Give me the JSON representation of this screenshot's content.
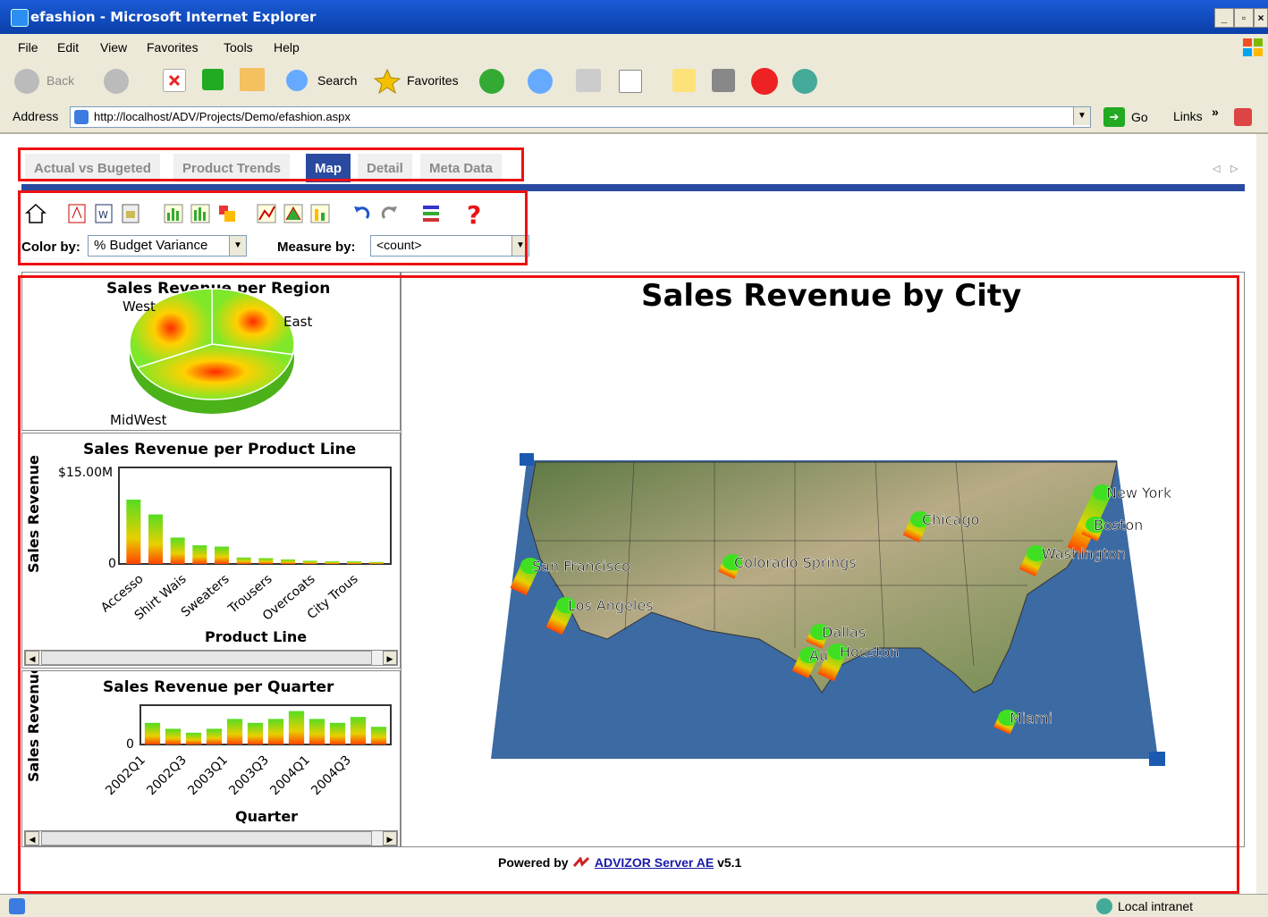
{
  "window": {
    "title": "efashion - Microsoft Internet Explorer"
  },
  "menu": [
    "File",
    "Edit",
    "View",
    "Favorites",
    "Tools",
    "Help"
  ],
  "toolbar": {
    "back": "Back",
    "search": "Search",
    "favorites": "Favorites",
    "go": "Go",
    "links": "Links"
  },
  "address": {
    "label": "Address",
    "url": "http://localhost/ADV/Projects/Demo/efashion.aspx"
  },
  "tabs": [
    "Actual vs Bugeted",
    "Product Trends",
    "Map",
    "Detail",
    "Meta Data"
  ],
  "active_tab": "Map",
  "controls": {
    "color_by_label": "Color by:",
    "color_by_value": "% Budget Variance",
    "measure_by_label": "Measure by:",
    "measure_by_value": "<count>"
  },
  "footer": {
    "powered_by": "Powered by",
    "link": "ADVIZOR Server AE",
    "version": "v5.1"
  },
  "status": {
    "zone": "Local intranet"
  },
  "colors": {
    "accent": "#2a4aa0",
    "highlight": "#ee1111",
    "bar_top": "#55dd22",
    "bar_bottom": "#ff4400"
  },
  "chart_data": [
    {
      "type": "pie",
      "title": "Sales Revenue per Region",
      "labels": [
        "West",
        "East",
        "MidWest"
      ],
      "values": [
        28,
        40,
        32
      ]
    },
    {
      "type": "bar",
      "title": "Sales Revenue per Product Line",
      "ylabel": "Sales Revenue",
      "xlabel": "Product Line",
      "ytick_labels": [
        "$15.00M",
        "0"
      ],
      "ylim": [
        0,
        15000000
      ],
      "categories": [
        "Accesso",
        "Shirt Wais",
        "Sweaters",
        "Trousers",
        "Overcoats",
        "City Trous"
      ],
      "values": [
        10000000,
        7700000,
        4100000,
        2900000,
        2700000,
        1000000,
        900000,
        700000,
        500000,
        400000,
        400000,
        300000
      ]
    },
    {
      "type": "bar",
      "title": "Sales Revenue per Quarter",
      "ylabel": "Sales Revenue",
      "xlabel": "Quarter",
      "ytick_labels": [
        "0"
      ],
      "categories": [
        "2002Q1",
        "2002Q3",
        "2003Q1",
        "2003Q3",
        "2004Q1",
        "2004Q3"
      ],
      "values": [
        5.5,
        4.0,
        3.0,
        4.0,
        6.5,
        5.5,
        6.5,
        8.5,
        6.5,
        5.5,
        7.0,
        4.5
      ]
    },
    {
      "type": "map",
      "title": "Sales Revenue by City",
      "cities": [
        {
          "name": "New York",
          "value": 9
        },
        {
          "name": "Boston",
          "value": 2
        },
        {
          "name": "Washington",
          "value": 3
        },
        {
          "name": "Chicago",
          "value": 3
        },
        {
          "name": "Colorado Springs",
          "value": 2
        },
        {
          "name": "San Francisco",
          "value": 4
        },
        {
          "name": "Los Angeles",
          "value": 4
        },
        {
          "name": "Dallas",
          "value": 2
        },
        {
          "name": "Houston",
          "value": 4
        },
        {
          "name": "Au",
          "value": 3
        },
        {
          "name": "Miami",
          "value": 2
        }
      ]
    }
  ]
}
